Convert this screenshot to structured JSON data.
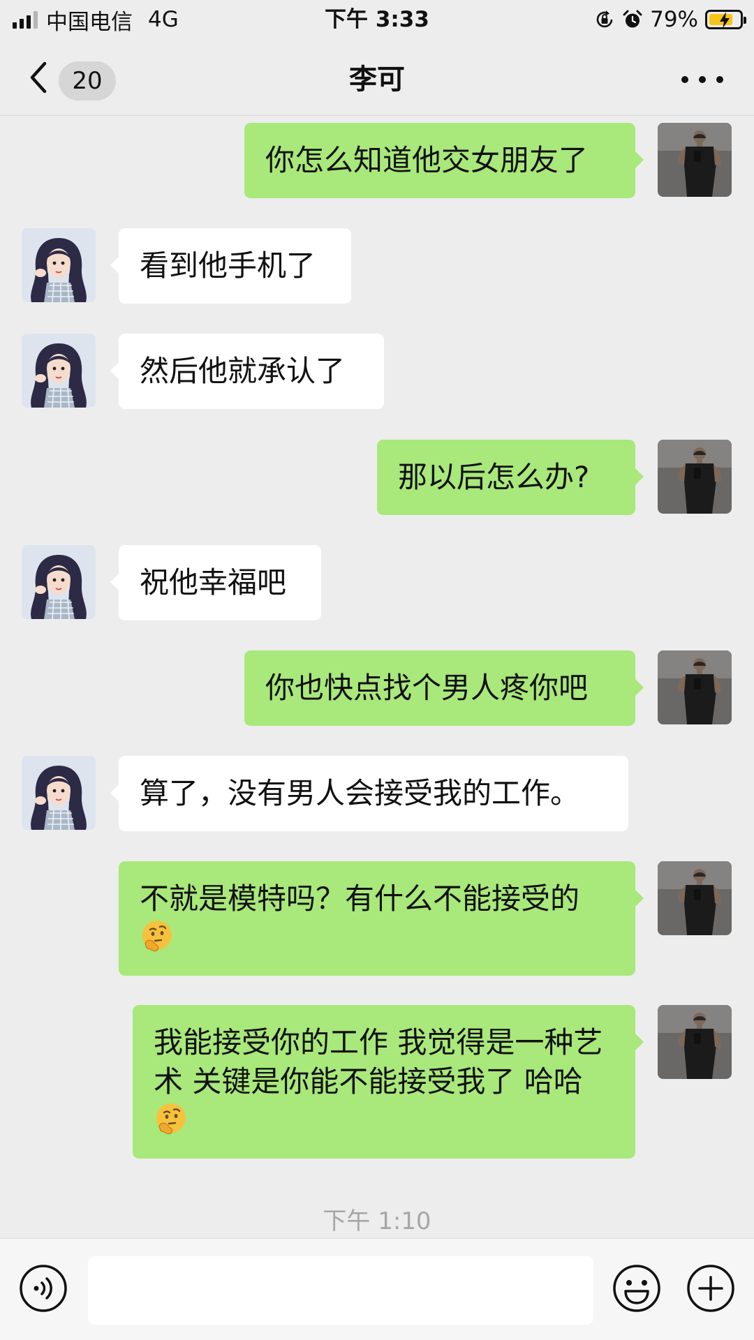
{
  "status_bar": {
    "carrier": "中国电信",
    "network": "4G",
    "time": "下午 3:33",
    "battery_percent": "79%",
    "battery_level": 0.79,
    "signal_bars": 3,
    "icons": [
      "orientation-lock-icon",
      "alarm-icon",
      "battery-charging-icon"
    ]
  },
  "nav": {
    "unread_count": "20",
    "title": "李可",
    "icons": [
      "back-chevron-icon",
      "more-dots-icon"
    ]
  },
  "messages": [
    {
      "side": "out",
      "text": "你怎么知道他交女朋友了"
    },
    {
      "side": "in",
      "text": "看到他手机了"
    },
    {
      "side": "in",
      "text": "然后他就承认了"
    },
    {
      "side": "out",
      "text": "那以后怎么办?"
    },
    {
      "side": "in",
      "text": "祝他幸福吧"
    },
    {
      "side": "out",
      "text": "你也快点找个男人疼你吧"
    },
    {
      "side": "in",
      "text": "算了，没有男人会接受我的工作。"
    },
    {
      "side": "out",
      "text": "不就是模特吗？有什么不能接受的",
      "emoji": "thinking-face-emoji"
    },
    {
      "side": "out",
      "text": "我能接受你的工作 我觉得是一种艺术 关键是你能不能接受我了 哈哈",
      "emoji": "thinking-face-emoji"
    }
  ],
  "timestamp": "下午 1:10",
  "input_bar": {
    "value": "",
    "placeholder": "",
    "icons": [
      "voice-icon",
      "emoji-icon",
      "plus-icon"
    ]
  },
  "colors": {
    "background": "#ededed",
    "outgoing_bubble": "#a9e87a",
    "incoming_bubble": "#ffffff",
    "timestamp_text": "#a6a6a6",
    "battery_fill": "#f5c518"
  }
}
